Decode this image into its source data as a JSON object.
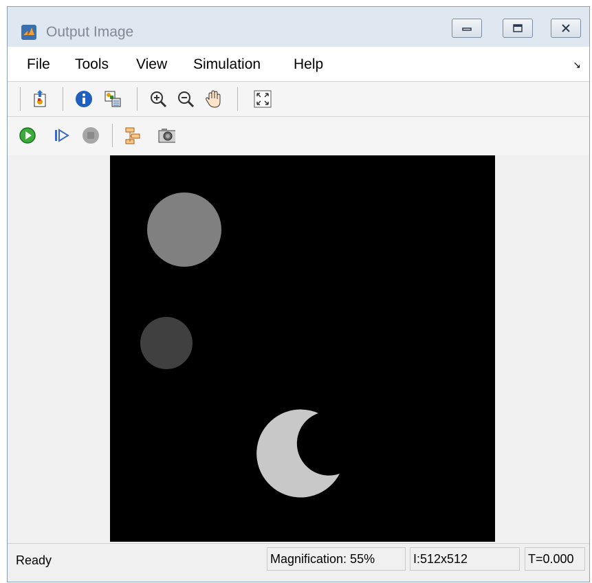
{
  "window": {
    "title": "Output Image"
  },
  "menu": {
    "items": [
      "File",
      "Tools",
      "View",
      "Simulation",
      "Help"
    ]
  },
  "toolbar1": {
    "icons": [
      "go-to-parent-icon",
      "info-icon",
      "export-to-workspace-icon",
      "zoom-in-icon",
      "zoom-out-icon",
      "pan-hand-icon",
      "fit-to-view-icon"
    ]
  },
  "toolbar2": {
    "icons": [
      "run-icon",
      "step-forward-icon",
      "stop-icon",
      "highlight-block-icon",
      "snapshot-camera-icon"
    ]
  },
  "image": {
    "background": "#000000",
    "objects": [
      {
        "label": "circle-top",
        "color": "#808080"
      },
      {
        "label": "circle-middle",
        "color": "#404040"
      },
      {
        "label": "moon-shape-bottom",
        "color": "#c8c8c8"
      }
    ]
  },
  "status": {
    "ready": "Ready",
    "magnification": "Magnification: 55%",
    "dimensions": "I:512x512",
    "time": "T=0.000"
  }
}
